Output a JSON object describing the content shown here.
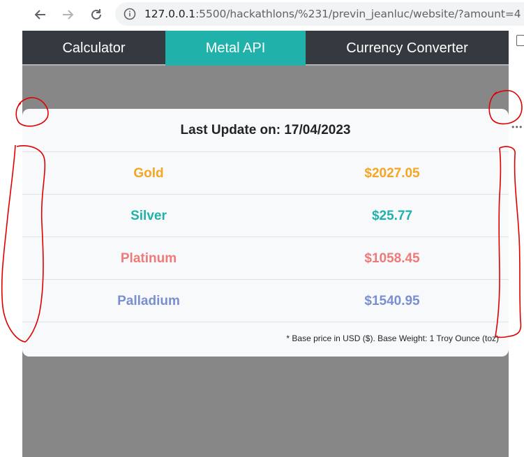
{
  "browser": {
    "url_host": "127.0.0.1",
    "url_rest": ":5500/hackathlons/%231/previn_jeanluc/website/?amount=4"
  },
  "tabs": [
    {
      "label": "Calculator",
      "active": false
    },
    {
      "label": "Metal API",
      "active": true
    },
    {
      "label": "Currency Converter",
      "active": false
    }
  ],
  "card": {
    "title": "Last Update on: 17/04/2023",
    "metals": [
      {
        "name": "Gold",
        "price": "$2027.05",
        "color": "#f5a623"
      },
      {
        "name": "Silver",
        "price": "$25.77",
        "color": "#20b2aa"
      },
      {
        "name": "Platinum",
        "price": "$1058.45",
        "color": "#ef7a7a"
      },
      {
        "name": "Palladium",
        "price": "$1540.95",
        "color": "#7a8fd1"
      }
    ],
    "footnote": "* Base price in USD ($). Base Weight: 1 Troy Ounce (toz)"
  },
  "colors": {
    "tabbar": "#343a40",
    "active_tab": "#20b2aa",
    "page_bg": "#878787",
    "annotation": "#e00000"
  }
}
